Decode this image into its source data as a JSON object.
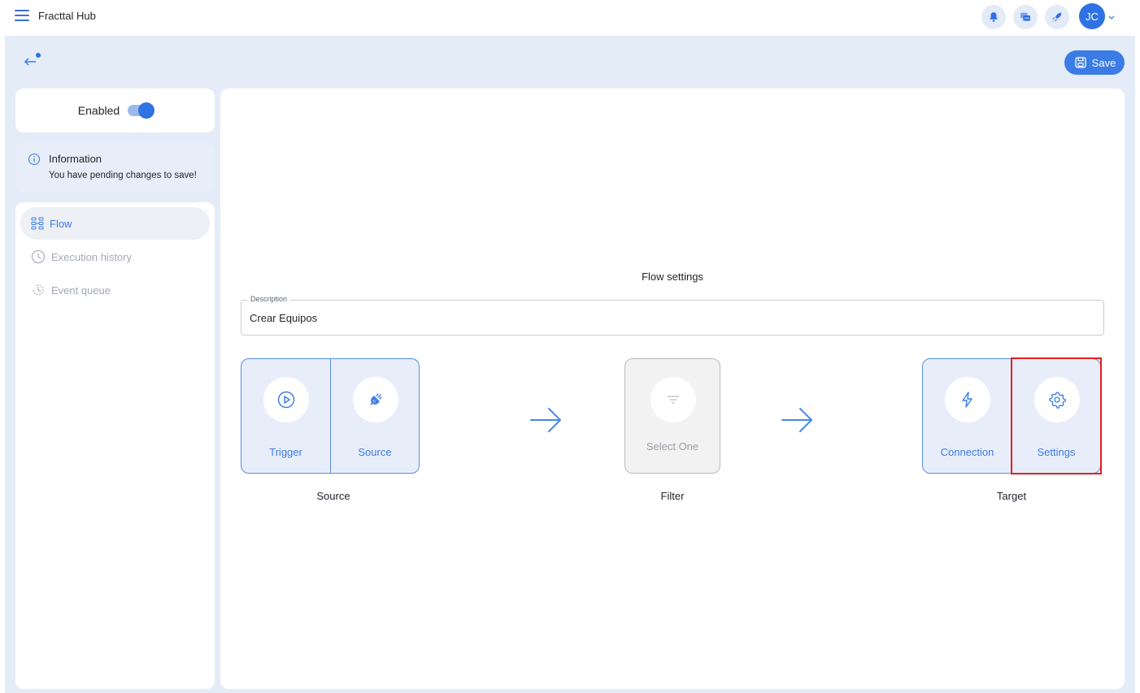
{
  "app": {
    "title": "Fracttal Hub"
  },
  "user": {
    "initials": "JC"
  },
  "header_icons": [
    "bell-icon",
    "chat-icon",
    "rocket-icon"
  ],
  "toolbar": {
    "save_label": "Save"
  },
  "status": {
    "enabled_label": "Enabled",
    "enabled": true
  },
  "info": {
    "title": "Information",
    "message": "You have pending changes to save!"
  },
  "nav": {
    "items": [
      {
        "label": "Flow",
        "icon": "flow-icon",
        "active": true
      },
      {
        "label": "Execution history",
        "icon": "clock-icon",
        "active": false
      },
      {
        "label": "Event queue",
        "icon": "history-icon",
        "active": false
      }
    ]
  },
  "flow": {
    "title": "Flow settings",
    "description_label": "Description",
    "description_value": "Crear Equipos",
    "source": {
      "group_label": "Source",
      "trigger_label": "Trigger",
      "source_label": "Source"
    },
    "filter": {
      "group_label": "Filter",
      "placeholder": "Select One"
    },
    "target": {
      "group_label": "Target",
      "connection_label": "Connection",
      "settings_label": "Settings"
    }
  },
  "colors": {
    "accent": "#3b7be6",
    "workspace_bg": "#e4ecf8",
    "highlight": "#e02020"
  }
}
